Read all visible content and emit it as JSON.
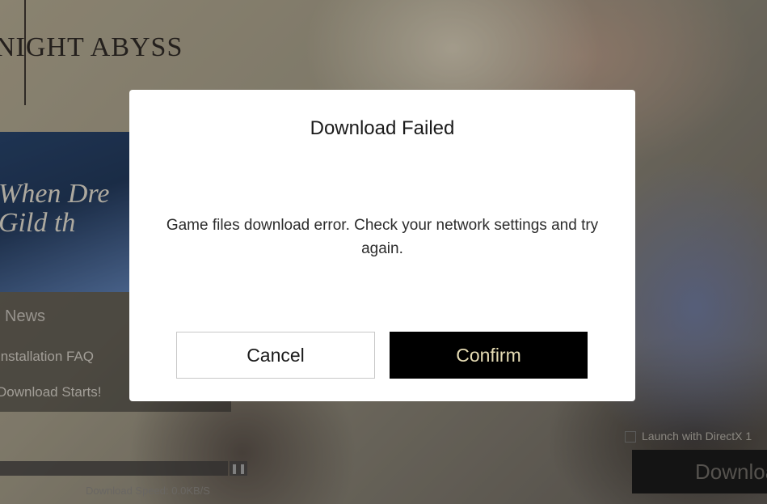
{
  "launcher": {
    "logo_text": "NIGHT ABYSS",
    "banner_text": "When Dre\nGild th",
    "news": {
      "title": "News",
      "items": [
        "Installation FAQ",
        "Download Starts!"
      ]
    },
    "download_speed": "Download Speed: 0.0KB/S",
    "pause_icon": "pause-icon",
    "directx_label": "Launch with DirectX 1",
    "download_button": "Download"
  },
  "dialog": {
    "title": "Download Failed",
    "message": "Game files download error. Check your network settings and try again.",
    "cancel_label": "Cancel",
    "confirm_label": "Confirm"
  },
  "colors": {
    "dialog_bg": "#ffffff",
    "confirm_bg": "#000000",
    "confirm_text": "#e6dcb4"
  }
}
